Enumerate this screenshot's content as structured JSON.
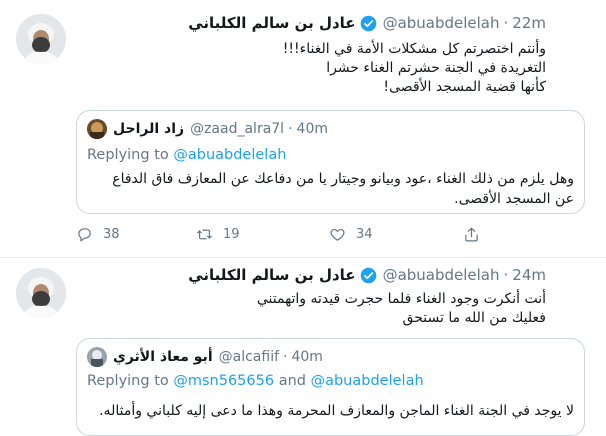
{
  "tweets": [
    {
      "author_name": "عادل بن سالم الكلباني",
      "handle": "@abuabdelelah",
      "separator": "·",
      "time": "22m",
      "text_lines": [
        "وأنتم اختصرتم كل مشكلات الأمة في الغناء!!!",
        "التغريدة في الجنة حشرتم الغناء حشرا",
        "كأنها قضية المسجد الأقصى!"
      ],
      "quote": {
        "author_name": "زاد الراحل",
        "handle": "@zaad_alra7l",
        "separator": "·",
        "time": "40m",
        "replying_prefix": "Replying to ",
        "replying_mentions": "@abuabdelelah",
        "replying_mid": "",
        "replying_mentions_2": "",
        "text": "وهل يلزم من ذلك الغناء ،عود وبيانو وجيتار يا من دفاعك عن المعازف فاق الدفاع عن المسجد الأقصى."
      },
      "actions": {
        "reply_count": "38",
        "retweet_count": "19",
        "like_count": "34"
      }
    },
    {
      "author_name": "عادل بن سالم الكلباني",
      "handle": "@abuabdelelah",
      "separator": "·",
      "time": "24m",
      "text_lines": [
        "أنت أنكرت وجود الغناء فلما حجرت قيدته واتهمتني",
        "فعليك من الله ما تستحق"
      ],
      "quote": {
        "author_name": "أبو معاذ الأثري",
        "handle": "@alcafiif",
        "separator": "·",
        "time": "40m",
        "replying_prefix": "Replying to ",
        "replying_mentions": "@msn565656",
        "replying_mid": " and ",
        "replying_mentions_2": "@abuabdelelah",
        "text": "لا يوجد في الجنة الغناء الماجن والمعازف المحرمة وهذا ما دعى إليه كلباني وأمثاله."
      }
    }
  ],
  "colors": {
    "accent": "#1da1f2",
    "secondary_text": "#657786",
    "border": "#ccd6dd"
  }
}
